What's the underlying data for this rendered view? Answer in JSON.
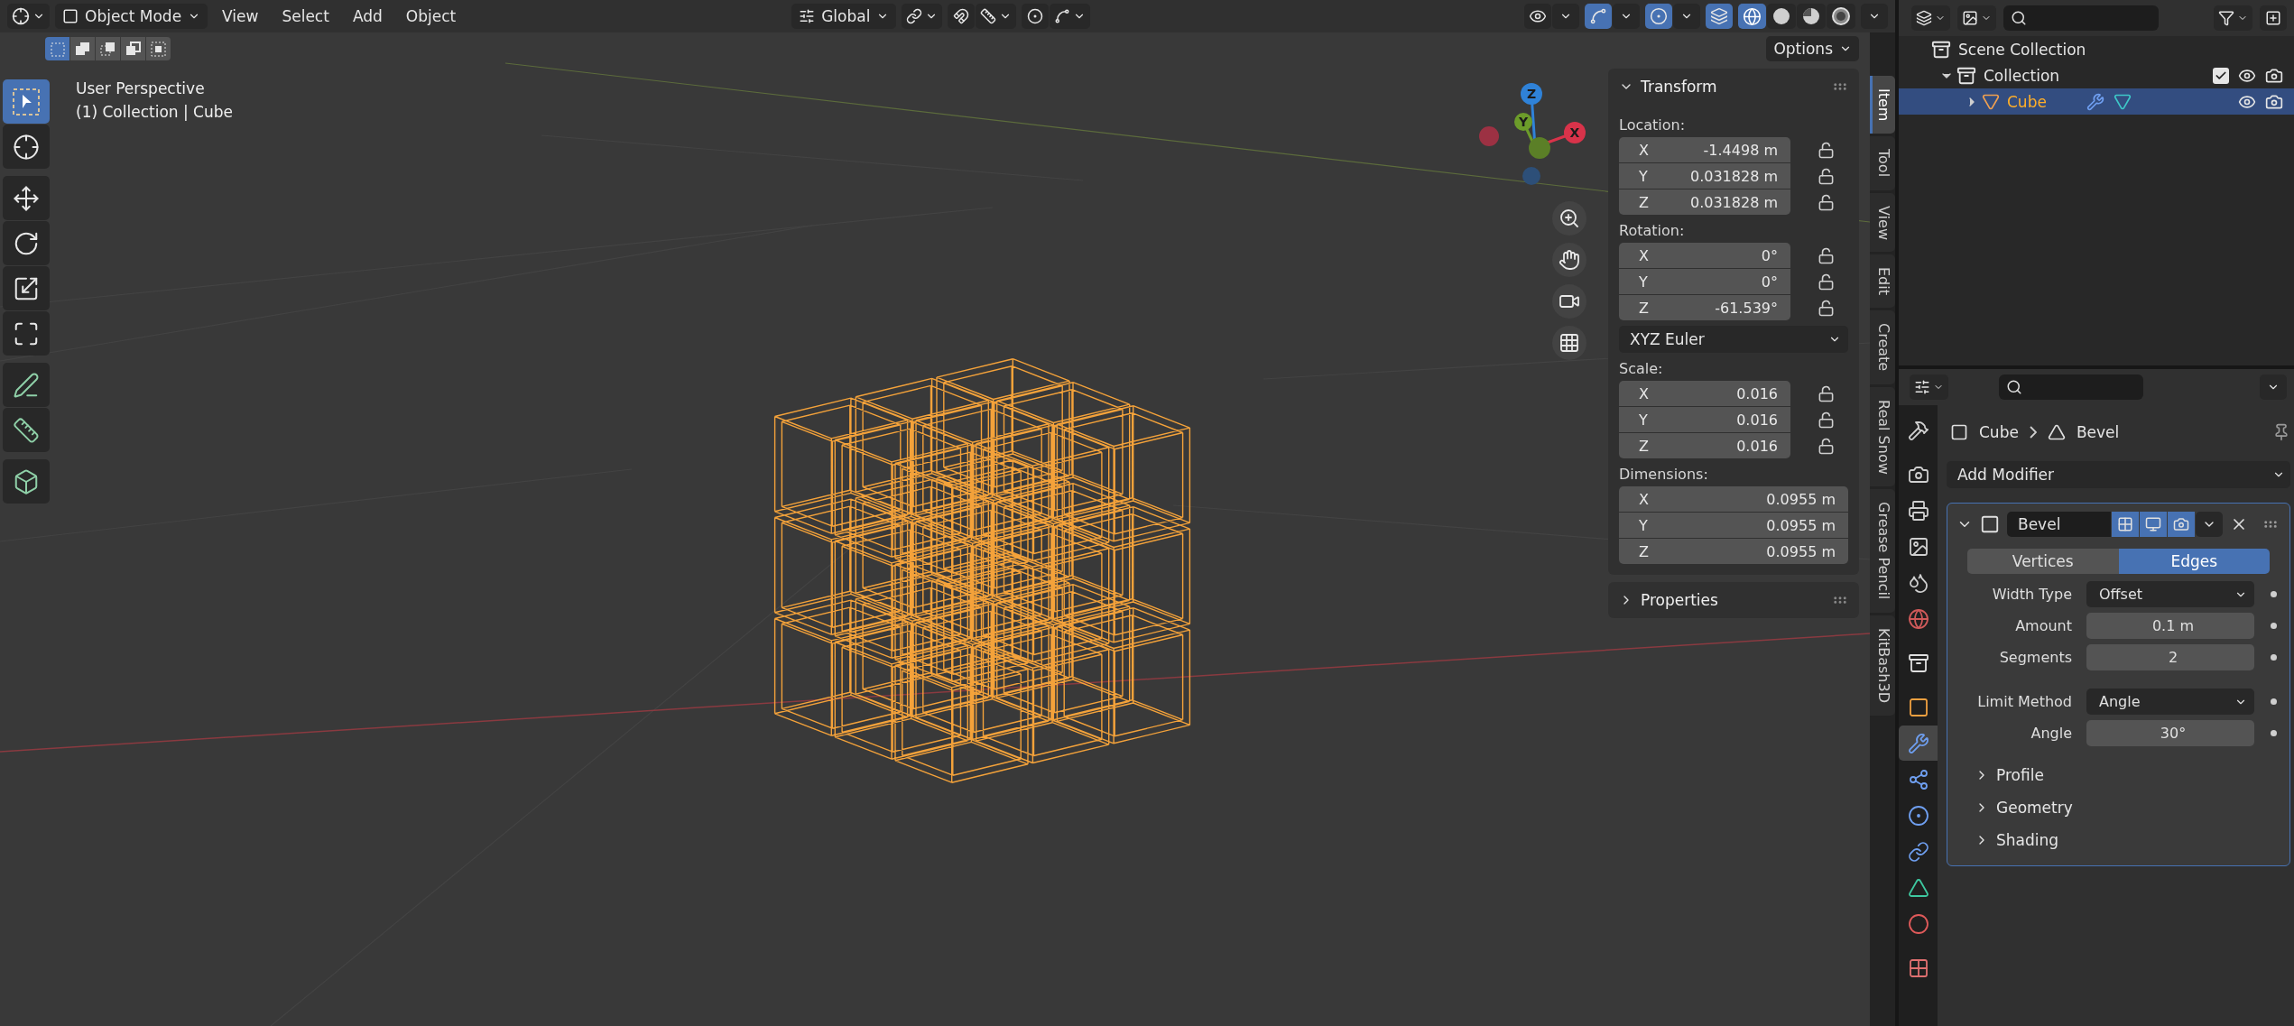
{
  "viewport_header": {
    "mode": "Object Mode",
    "menus": [
      "View",
      "Select",
      "Add",
      "Object"
    ],
    "orientation": "Global",
    "view_toggles": [
      {
        "kind": "selectability",
        "on": false
      },
      {
        "kind": "gizmo",
        "on": true
      },
      {
        "kind": "overlays",
        "on": true
      },
      {
        "kind": "xray",
        "on": true
      }
    ],
    "shading_modes": [
      {
        "kind": "wireframe",
        "selected": true
      },
      {
        "kind": "solid",
        "selected": false
      },
      {
        "kind": "material",
        "selected": false
      },
      {
        "kind": "rendered",
        "selected": false
      }
    ]
  },
  "select_modes": [
    {
      "kind": "set",
      "selected": true
    },
    {
      "kind": "extend",
      "selected": false
    },
    {
      "kind": "subtract",
      "selected": false
    },
    {
      "kind": "difference",
      "selected": false
    },
    {
      "kind": "intersect",
      "selected": false
    }
  ],
  "options": "Options",
  "viewport_info": [
    "User Perspective",
    "(1) Collection | Cube"
  ],
  "tool_groups": [
    {
      "tools": [
        {
          "kind": "select_box",
          "selected": true
        },
        {
          "kind": "cursor",
          "selected": false
        }
      ]
    },
    {
      "tools": [
        {
          "kind": "move",
          "selected": false
        },
        {
          "kind": "rotate",
          "selected": false
        },
        {
          "kind": "scale",
          "selected": false
        },
        {
          "kind": "transform",
          "selected": false
        }
      ]
    },
    {
      "tools": [
        {
          "kind": "annotate",
          "selected": false
        },
        {
          "kind": "measure",
          "selected": false
        }
      ]
    },
    {
      "tools": [
        {
          "kind": "add_cube",
          "selected": false
        }
      ]
    }
  ],
  "gizmo": [
    {
      "kind": "neg_x",
      "color": "#9c3143"
    },
    {
      "kind": "neg_z",
      "color": "#2d4f78"
    },
    {
      "kind": "neg_y",
      "color": "#5b7f27"
    },
    {
      "kind": "z",
      "label": "Z",
      "color": "#2f82d8"
    },
    {
      "kind": "y",
      "label": "Y",
      "color": "#6c9c2a"
    },
    {
      "kind": "x",
      "label": "X",
      "color": "#d8334a"
    }
  ],
  "nav_buttons": [
    {
      "kind": "zoom"
    },
    {
      "kind": "pan"
    },
    {
      "kind": "camera"
    },
    {
      "kind": "ortho"
    }
  ],
  "sidebar": {
    "panels": [
      {
        "title": "Transform",
        "expanded": true,
        "groups": [
          {
            "label": "Location:",
            "lockable": true,
            "rows": [
              {
                "axis": "X",
                "value": "-1.4498 m",
                "locked": false
              },
              {
                "axis": "Y",
                "value": "0.031828 m",
                "locked": false
              },
              {
                "axis": "Z",
                "value": "0.031828 m",
                "locked": false
              }
            ]
          },
          {
            "label": "Rotation:",
            "lockable": true,
            "rows": [
              {
                "axis": "X",
                "value": "0°",
                "locked": false
              },
              {
                "axis": "Y",
                "value": "0°",
                "locked": false
              },
              {
                "axis": "Z",
                "value": "-61.539°",
                "locked": false
              }
            ],
            "mode": "XYZ Euler"
          },
          {
            "label": "Scale:",
            "lockable": true,
            "rows": [
              {
                "axis": "X",
                "value": "0.016",
                "locked": false
              },
              {
                "axis": "Y",
                "value": "0.016",
                "locked": false
              },
              {
                "axis": "Z",
                "value": "0.016",
                "locked": false
              }
            ]
          },
          {
            "label": "Dimensions:",
            "lockable": false,
            "rows": [
              {
                "axis": "X",
                "value": "0.0955 m"
              },
              {
                "axis": "Y",
                "value": "0.0955 m"
              },
              {
                "axis": "Z",
                "value": "0.0955 m"
              }
            ]
          }
        ]
      },
      {
        "title": "Properties",
        "expanded": false
      }
    ],
    "tabs": [
      {
        "label": "Item",
        "selected": true
      },
      {
        "label": "Tool",
        "selected": false
      },
      {
        "label": "View",
        "selected": false
      },
      {
        "label": "Edit",
        "selected": false
      },
      {
        "label": "Create",
        "selected": false
      },
      {
        "label": "Real Snow",
        "selected": false
      },
      {
        "label": "Grease Pencil",
        "selected": false
      },
      {
        "label": "KitBash3D",
        "selected": false
      }
    ]
  },
  "outliner": {
    "tree": [
      {
        "name": "Scene Collection",
        "kind": "scene",
        "selected": false,
        "children": [
          {
            "name": "Collection",
            "kind": "collection",
            "expanded": true,
            "checked": true,
            "selected": false,
            "children": [
              {
                "name": "Cube",
                "kind": "object",
                "expanded": false,
                "selected": true
              }
            ]
          }
        ]
      }
    ]
  },
  "properties": {
    "tab_groups": [
      {
        "tabs": [
          {
            "kind": "tool",
            "selected": false
          }
        ]
      },
      {
        "tabs": [
          {
            "kind": "render",
            "selected": false
          },
          {
            "kind": "output",
            "selected": false
          },
          {
            "kind": "view_layer",
            "selected": false
          },
          {
            "kind": "scene",
            "selected": false
          },
          {
            "kind": "world",
            "selected": false
          }
        ]
      },
      {
        "tabs": [
          {
            "kind": "collection",
            "selected": false
          }
        ]
      },
      {
        "tabs": [
          {
            "kind": "object",
            "selected": false
          },
          {
            "kind": "modifier",
            "selected": true
          },
          {
            "kind": "particles",
            "selected": false
          },
          {
            "kind": "physics",
            "selected": false
          },
          {
            "kind": "constraints",
            "selected": false
          },
          {
            "kind": "data",
            "selected": false
          },
          {
            "kind": "material",
            "selected": false
          }
        ]
      },
      {
        "tabs": [
          {
            "kind": "texture",
            "selected": false
          }
        ]
      }
    ],
    "breadcrumb": [
      {
        "kind": "object",
        "label": "Cube"
      },
      {
        "kind": "modifier",
        "label": "Bevel"
      }
    ],
    "add_modifier": "Add Modifier",
    "modifier": {
      "name": "Bevel",
      "expanded": true,
      "toggles": [
        {
          "kind": "edit_mode",
          "on": true
        },
        {
          "kind": "viewport",
          "on": true
        },
        {
          "kind": "render",
          "on": true
        }
      ],
      "affect": [
        {
          "label": "Vertices",
          "selected": false
        },
        {
          "label": "Edges",
          "selected": true
        }
      ],
      "field_groups": [
        {
          "fields": [
            {
              "kind": "dropdown",
              "label": "Width Type",
              "value": "Offset"
            },
            {
              "kind": "number",
              "label": "Amount",
              "value": "0.1 m"
            },
            {
              "kind": "number",
              "label": "Segments",
              "value": "2"
            }
          ]
        },
        {
          "fields": [
            {
              "kind": "dropdown",
              "label": "Limit Method",
              "value": "Angle"
            },
            {
              "kind": "number",
              "label": "Angle",
              "value": "30°"
            }
          ]
        }
      ],
      "subpanels": [
        {
          "label": "Profile",
          "expanded": false
        },
        {
          "label": "Geometry",
          "expanded": false
        },
        {
          "label": "Shading",
          "expanded": false
        }
      ]
    }
  }
}
